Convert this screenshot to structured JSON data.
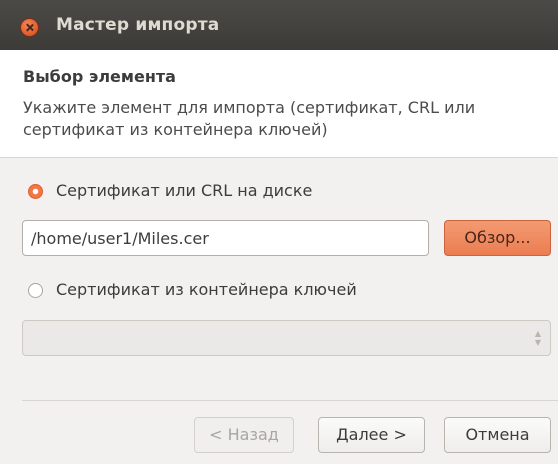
{
  "window": {
    "title": "Мастер импорта"
  },
  "header": {
    "section_title": "Выбор элемента",
    "description": "Укажите элемент для импорта (сертификат, CRL или сертификат из контейнера ключей)"
  },
  "options": {
    "disk": {
      "label": "Сертификат или CRL на диске",
      "selected": true
    },
    "path_value": "/home/user1/Miles.cer",
    "browse_label": "Обзор...",
    "container": {
      "label": "Сертификат из контейнера ключей",
      "selected": false
    },
    "container_combo_value": ""
  },
  "footer": {
    "back_label": "< Назад",
    "next_label": "Далее >",
    "cancel_label": "Отмена"
  },
  "colors": {
    "accent": "#ec7d51",
    "titlebar": "#3c3b37"
  }
}
